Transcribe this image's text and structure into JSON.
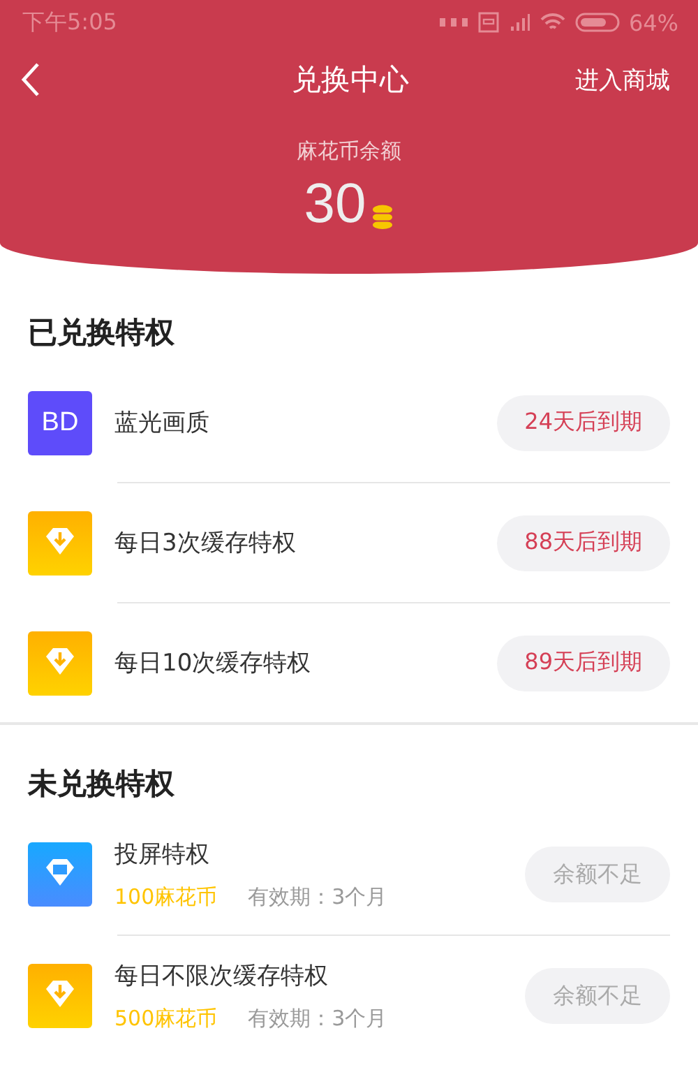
{
  "status_bar": {
    "time": "下午5:05",
    "battery": "64%"
  },
  "header": {
    "title": "兑换中心",
    "action": "进入商城",
    "balance_label": "麻花币余额",
    "balance": "30"
  },
  "redeemed": {
    "title": "已兑换特权",
    "items": [
      {
        "kind": "bd",
        "icon_text": "BD",
        "name": "蓝光画质",
        "status": "24天后到期"
      },
      {
        "kind": "download",
        "name": "每日3次缓存特权",
        "status": "88天后到期"
      },
      {
        "kind": "download",
        "name": "每日10次缓存特权",
        "status": "89天后到期"
      }
    ]
  },
  "unredeemed": {
    "title": "未兑换特权",
    "items": [
      {
        "kind": "screen",
        "name": "投屏特权",
        "price": "100麻花币",
        "validity": "有效期：3个月",
        "button": "余额不足",
        "disabled": true
      },
      {
        "kind": "download",
        "name": "每日不限次缓存特权",
        "price": "500麻花币",
        "validity": "有效期：3个月",
        "button": "余额不足",
        "disabled": true
      }
    ]
  }
}
